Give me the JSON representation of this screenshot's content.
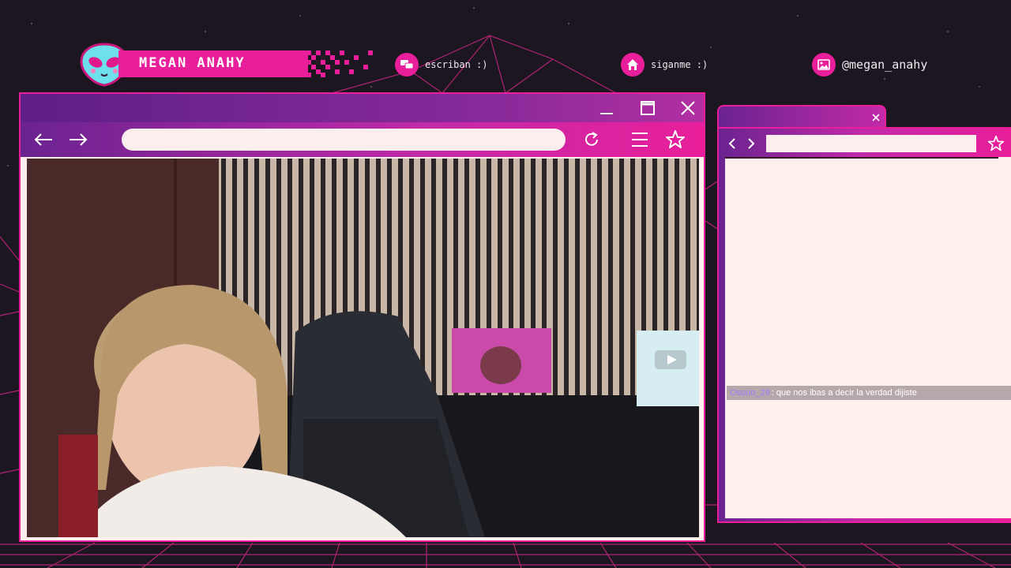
{
  "header": {
    "streamer_name": "MEGAN ANAHY",
    "social": [
      {
        "icon": "chat-bubbles-icon",
        "label": "escriban :)"
      },
      {
        "icon": "home-icon",
        "label": "siganme :)"
      },
      {
        "icon": "image-icon",
        "label": "@megan_anahy"
      }
    ]
  },
  "main_window": {
    "url_value": "",
    "controls": [
      "minimize",
      "maximize",
      "close"
    ]
  },
  "side_window": {
    "url_value": "",
    "chat": [
      {
        "user": "Osorio_29",
        "message": ": que nos ibas a decir la verdad dijiste"
      }
    ]
  },
  "colors": {
    "accent": "#e91e9a",
    "purple": "#6a2390",
    "panel": "#fff0ee",
    "background": "#1c1620"
  }
}
